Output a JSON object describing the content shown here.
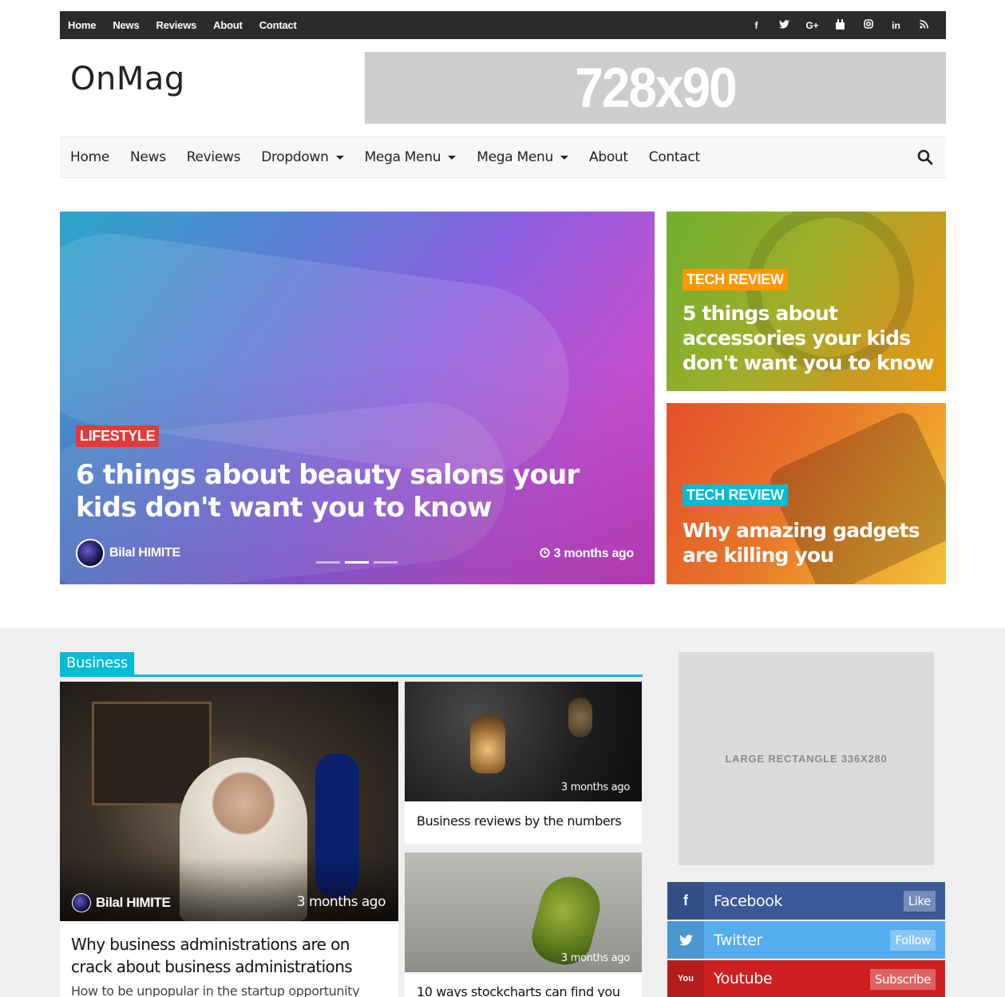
{
  "top_nav": [
    "Home",
    "News",
    "Reviews",
    "About",
    "Contact"
  ],
  "social_icons": [
    {
      "name": "facebook-icon",
      "glyph": "f"
    },
    {
      "name": "twitter-icon",
      "glyph": "🐦"
    },
    {
      "name": "google-plus-icon",
      "glyph": "G+"
    },
    {
      "name": "youtube-icon",
      "glyph": "▶"
    },
    {
      "name": "instagram-icon",
      "glyph": "◎"
    },
    {
      "name": "linkedin-icon",
      "glyph": "in"
    },
    {
      "name": "rss-icon",
      "glyph": "◔"
    }
  ],
  "logo": "OnMag",
  "banner": "728x90",
  "main_nav": [
    {
      "label": "Home",
      "dropdown": false
    },
    {
      "label": "News",
      "dropdown": false
    },
    {
      "label": "Reviews",
      "dropdown": false
    },
    {
      "label": "Dropdown",
      "dropdown": true
    },
    {
      "label": "Mega Menu",
      "dropdown": true
    },
    {
      "label": "Mega Menu",
      "dropdown": true
    },
    {
      "label": "About",
      "dropdown": false
    },
    {
      "label": "Contact",
      "dropdown": false
    }
  ],
  "hero": {
    "category": "LIFESTYLE",
    "category_color": "#e53935",
    "title": "6 things about beauty salons your kids don't want you to know",
    "author": "Bilal HIMITE",
    "time": "3 months ago",
    "slides": 3,
    "active_slide": 2
  },
  "side_posts": [
    {
      "category": "TECH REVIEW",
      "category_color": "#ff9800",
      "title": "5 things about accessories your kids don't want you to know"
    },
    {
      "category": "TECH REVIEW",
      "category_color": "#00bcd4",
      "title": "Why amazing gadgets are killing you"
    }
  ],
  "section": {
    "title": "Business",
    "accent": "#00bcd4",
    "main_post": {
      "author": "Bilal HIMITE",
      "time": "3 months ago",
      "title": "Why business administrations are on crack about business administrations",
      "excerpt": "How to be unpopular in the startup opportunity"
    },
    "side_posts": [
      {
        "time": "3 months ago",
        "title": "Business reviews by the numbers"
      },
      {
        "time": "3 months ago",
        "title": "10 ways stockcharts can find you"
      }
    ]
  },
  "ad_rect": "LARGE RECTANGLE 336X280",
  "social_buttons": [
    {
      "name": "Facebook",
      "action": "Like",
      "color": "#3b5998",
      "glyph": "f"
    },
    {
      "name": "Twitter",
      "action": "Follow",
      "color": "#55acee",
      "glyph": "🐦"
    },
    {
      "name": "Youtube",
      "action": "Subscribe",
      "color": "#cd201f",
      "glyph": "You"
    }
  ]
}
